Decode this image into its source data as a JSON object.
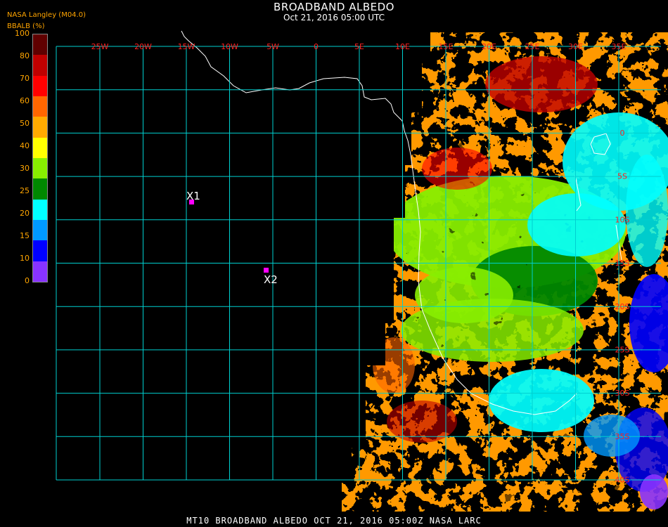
{
  "header": {
    "title": "BROADBAND ALBEDO",
    "datetime": "Oct 21, 2016 05:00 UTC",
    "source": "NASA Langley (M04.0)",
    "unit_label": "BBALB (%)"
  },
  "legend": {
    "ticks": [
      "100",
      "80",
      "70",
      "60",
      "50",
      "40",
      "30",
      "25",
      "20",
      "15",
      "10",
      "0"
    ],
    "colors": [
      "#600000",
      "#c00000",
      "#ff0000",
      "#ff6600",
      "#ffaa00",
      "#ffff00",
      "#88ee00",
      "#008800",
      "#00ffff",
      "#0099ff",
      "#0000ff",
      "#8833ff"
    ]
  },
  "grid": {
    "lon_labels": [
      "25W",
      "20W",
      "15W",
      "10W",
      "5W",
      "0",
      "5E",
      "10E",
      "15E",
      "20E",
      "25E",
      "30E",
      "35E"
    ],
    "lat_labels": [
      "0",
      "5S",
      "10S",
      "15S",
      "20S",
      "25S",
      "30S",
      "35S",
      "40S"
    ],
    "color": "#00d0d0",
    "label_color": "#ff2020"
  },
  "markers": [
    {
      "label": "X1",
      "color": "#ff00ff"
    },
    {
      "label": "X2",
      "color": "#ff00ff"
    }
  ],
  "footer": "MT10  BROADBAND ALBEDO  OCT 21, 2016 05:00Z  NASA LARC"
}
